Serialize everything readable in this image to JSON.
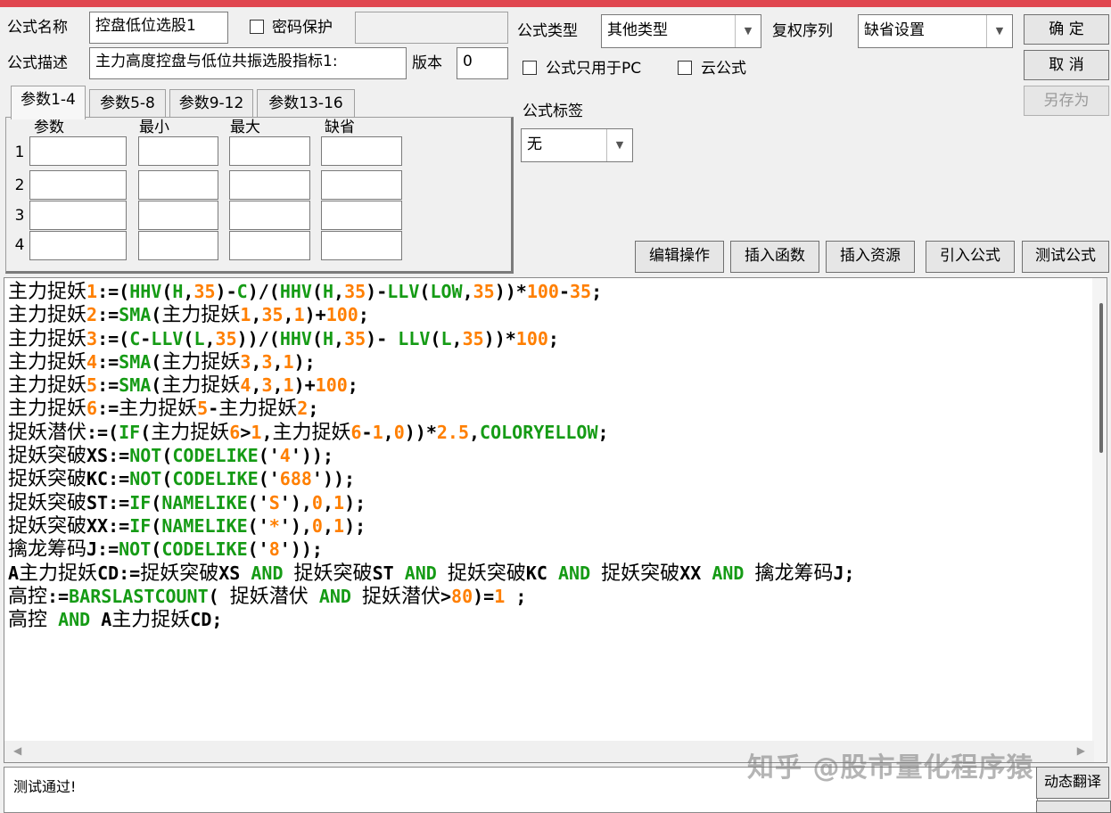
{
  "header": {
    "name_label": "公式名称",
    "name_value": "控盘低位选股1",
    "password_label": "密码保护",
    "desc_label": "公式描述",
    "desc_value": "主力高度控盘与低位共振选股指标1:",
    "version_label": "版本",
    "version_value": "0",
    "type_label": "公式类型",
    "type_value": "其他类型",
    "fuquan_label": "复权序列",
    "fuquan_value": "缺省设置",
    "pc_only_label": "公式只用于PC",
    "cloud_label": "云公式",
    "tag_label": "公式标签",
    "tag_value": "无"
  },
  "side_buttons": {
    "ok": "确  定",
    "cancel": "取  消",
    "save_as": "另存为"
  },
  "tabs": [
    "参数1-4",
    "参数5-8",
    "参数9-12",
    "参数13-16"
  ],
  "params": {
    "col_headers": [
      "参数",
      "最小",
      "最大",
      "缺省"
    ],
    "rows": [
      "1",
      "2",
      "3",
      "4"
    ]
  },
  "toolbar": [
    "编辑操作",
    "插入函数",
    "插入资源",
    "引入公式",
    "测试公式"
  ],
  "status_text": "测试通过!",
  "dyn_translate_label": "动态翻译",
  "watermark": "知乎 @股市量化程序猿",
  "code_lines": [
    "主力捉妖1:=(HHV(H,35)-C)/(HHV(H,35)-LLV(LOW,35))*100-35;",
    "主力捉妖2:=SMA(主力捉妖1,35,1)+100;",
    "主力捉妖3:=(C-LLV(L,35))/(HHV(H,35)- LLV(L,35))*100;",
    "主力捉妖4:=SMA(主力捉妖3,3,1);",
    "主力捉妖5:=SMA(主力捉妖4,3,1)+100;",
    "主力捉妖6:=主力捉妖5-主力捉妖2;",
    "捉妖潜伏:=(IF(主力捉妖6>1,主力捉妖6-1,0))*2.5,COLORYELLOW;",
    "捉妖突破XS:=NOT(CODELIKE('4'));",
    "捉妖突破KC:=NOT(CODELIKE('688'));",
    "捉妖突破ST:=IF(NAMELIKE('S'),0,1);",
    "捉妖突破XX:=IF(NAMELIKE('*'),0,1);",
    "擒龙筹码J:=NOT(CODELIKE('8'));",
    "A主力捉妖CD:=捉妖突破XS AND 捉妖突破ST AND 捉妖突破KC AND 捉妖突破XX AND 擒龙筹码J;",
    "高控:=BARSLASTCOUNT( 捉妖潜伏 AND 捉妖潜伏>80)=1 ;",
    "高控 AND A主力捉妖CD;"
  ]
}
